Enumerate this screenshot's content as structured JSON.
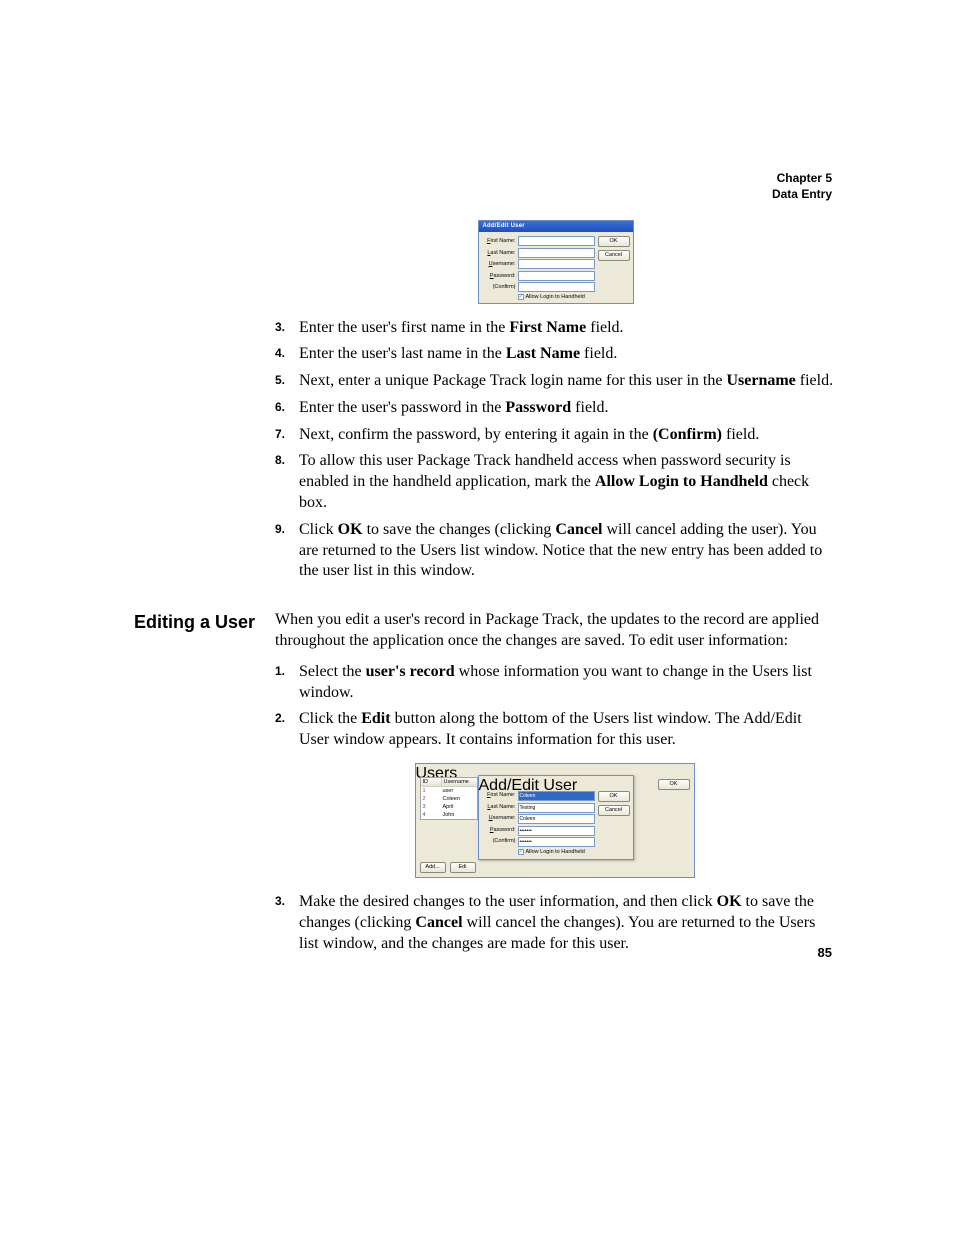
{
  "header": {
    "chapter": "Chapter 5",
    "section": "Data Entry"
  },
  "dialog1": {
    "title": "Add/Edit User",
    "labels": {
      "first_name": "First Name:",
      "last_name": "Last Name:",
      "username": "Username:",
      "password": "Password:",
      "confirm": "(Confirm)"
    },
    "checkbox": "Allow Login to Handheld",
    "buttons": {
      "ok": "OK",
      "cancel": "Cancel"
    }
  },
  "steps_a": [
    {
      "num": "3.",
      "pre": "Enter the user's first name in the ",
      "bold": "First Name",
      "post": " field."
    },
    {
      "num": "4.",
      "pre": "Enter the user's last name in the ",
      "bold": "Last Name",
      "post": " field."
    },
    {
      "num": "5.",
      "pre": "Next, enter a unique Package Track login name for this user in the ",
      "bold": "Username",
      "post": " field."
    },
    {
      "num": "6.",
      "pre": "Enter the user's password in the ",
      "bold": "Password",
      "post": " field."
    },
    {
      "num": "7.",
      "pre": "Next, confirm the password, by entering it again in the ",
      "bold": "(Confirm)",
      "post": " field."
    }
  ],
  "step_a8": {
    "num": "8.",
    "pre": "To allow this user Package Track handheld access when password security is enabled in the handheld application, mark the ",
    "bold": "Allow Login to Handheld",
    "post": " check box."
  },
  "step_a9": {
    "num": "9.",
    "p1": "Click ",
    "b1": "OK",
    "p2": " to save the changes (clicking ",
    "b2": "Cancel",
    "p3": " will cancel adding the user). You are returned to the Users list window. Notice that the new entry has been added to the user list in this window."
  },
  "section2": {
    "heading": "Editing a User",
    "intro": "When you edit a user's record in Package Track, the updates to the record are applied throughout the application once the changes are saved. To edit user information:"
  },
  "step_b1": {
    "num": "1.",
    "p1": "Select the ",
    "b1": "user's record",
    "p2": " whose information you want to change in the Users list window."
  },
  "step_b2": {
    "num": "2.",
    "p1": "Click the ",
    "b1": "Edit",
    "p2": " button along the bottom of the Users list window. The Add/Edit User window appears. It contains information for this user."
  },
  "dialog2": {
    "outer_title": "Users",
    "list_header": {
      "id": "ID",
      "username": "Username"
    },
    "list_rows": [
      {
        "id": "1",
        "name": "user"
      },
      {
        "id": "2",
        "name": "Coleen"
      },
      {
        "id": "3",
        "name": "April"
      },
      {
        "id": "4",
        "name": "John"
      }
    ],
    "btn_add": "Add...",
    "btn_edit": "Edit",
    "btn_ok": "OK",
    "inner": {
      "title": "Add/Edit User",
      "first_name_val": "Coleen",
      "last_name_val": "Testing",
      "username_val": "Coleen",
      "password_val": "•••••••",
      "confirm_val": "•••••••"
    }
  },
  "step_b3": {
    "num": "3.",
    "p1": "Make the desired changes to the user information, and then click ",
    "b1": "OK",
    "p2": " to save the changes (clicking ",
    "b2": "Cancel",
    "p3": " will cancel the changes). You are returned to the Users list window, and the changes are made for this user."
  },
  "page_number": "85"
}
